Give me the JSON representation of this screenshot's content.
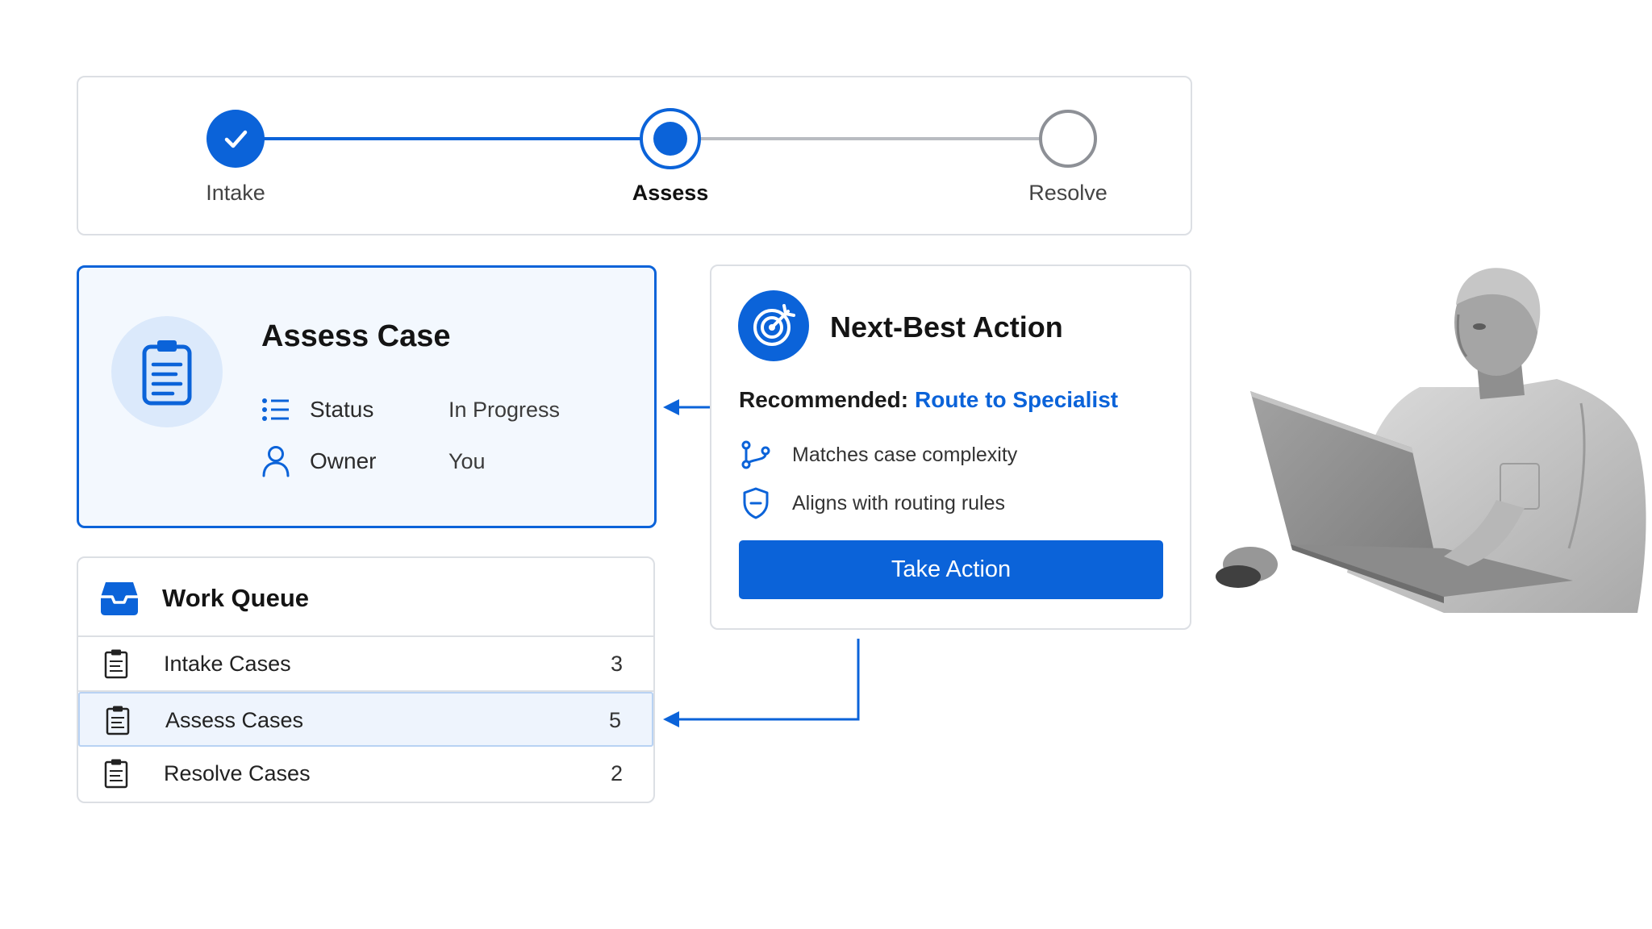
{
  "stepper": {
    "steps": [
      {
        "label": "Intake",
        "state": "complete"
      },
      {
        "label": "Assess",
        "state": "current"
      },
      {
        "label": "Resolve",
        "state": "pending"
      }
    ]
  },
  "assess_case": {
    "title": "Assess Case",
    "fields": [
      {
        "name": "Status",
        "value": "In Progress",
        "icon": "list-icon"
      },
      {
        "name": "Owner",
        "value": "You",
        "icon": "user-icon"
      }
    ]
  },
  "next_best_action": {
    "title": "Next-Best Action",
    "recommended_label": "Recommended:",
    "recommended_value": "Route to Specialist",
    "reasons": [
      {
        "text": "Matches case complexity",
        "icon": "branch-icon"
      },
      {
        "text": "Aligns with routing rules",
        "icon": "shield-icon"
      }
    ],
    "button_label": "Take Action"
  },
  "work_queue": {
    "title": "Work Queue",
    "rows": [
      {
        "name": "Intake Cases",
        "count": "3",
        "selected": false
      },
      {
        "name": "Assess Cases",
        "count": "5",
        "selected": true
      },
      {
        "name": "Resolve Cases",
        "count": "2",
        "selected": false
      }
    ]
  },
  "colors": {
    "accent": "#0b63d9",
    "selected_bg": "#eef4fd",
    "border": "#dcdfe4"
  }
}
